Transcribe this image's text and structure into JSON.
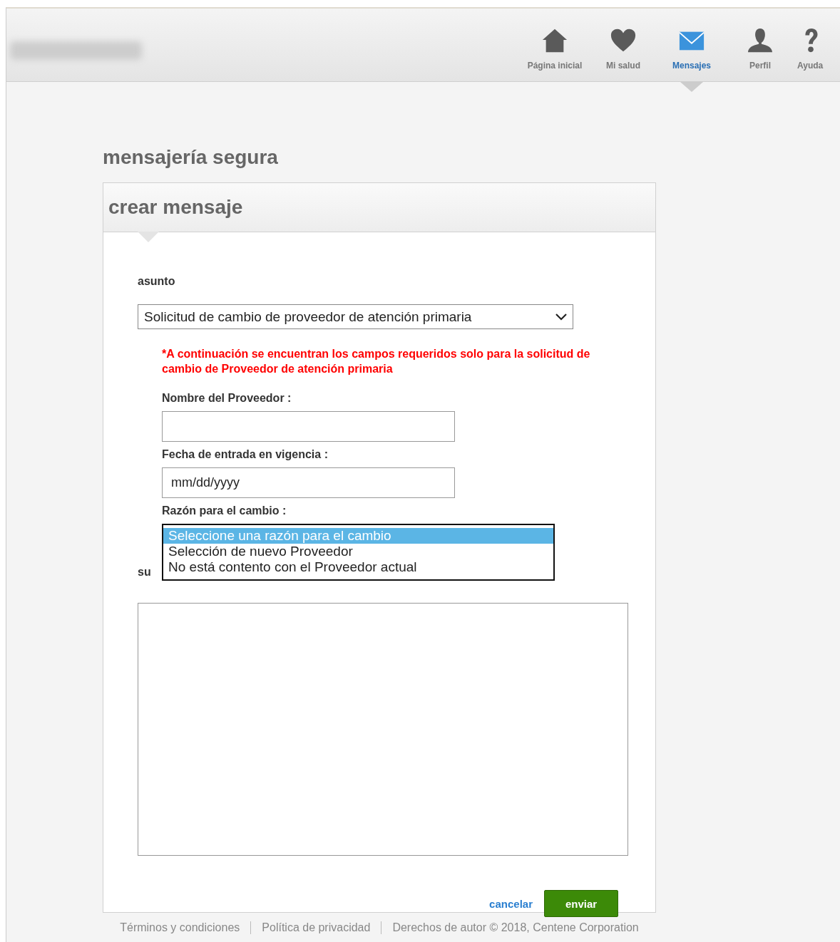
{
  "nav": [
    {
      "label": "Página inicial",
      "selected": false
    },
    {
      "label": "Mi salud",
      "selected": false
    },
    {
      "label": "Mensajes",
      "selected": true
    },
    {
      "label": "Perfil",
      "selected": false
    },
    {
      "label": "Ayuda",
      "selected": false
    }
  ],
  "page_title": "mensajería segura",
  "card_title": "crear mensaje",
  "subject": {
    "label": "asunto",
    "value": "Solicitud de cambio de proveedor de atención primaria"
  },
  "required_note": "*A continuación se encuentran los campos requeridos solo para la solicitud de cambio de Proveedor de atención primaria",
  "provider_name": {
    "label": "Nombre del Proveedor :"
  },
  "effective_date": {
    "label": "Fecha de entrada en vigencia :",
    "placeholder": "mm/dd/yyyy"
  },
  "reason": {
    "label": "Razón para el cambio :",
    "options": [
      {
        "label": "Seleccione una razón para el cambio",
        "selected": true
      },
      {
        "label": "Selección de nuevo Proveedor",
        "selected": false
      },
      {
        "label": "No está contento con el Proveedor actual",
        "selected": false
      }
    ]
  },
  "message_label": "su",
  "buttons": {
    "cancel": "cancelar",
    "send": "enviar"
  },
  "footer": [
    "Términos y condiciones",
    "Política de privacidad",
    "Derechos de autor © 2018, Centene Corporation"
  ]
}
